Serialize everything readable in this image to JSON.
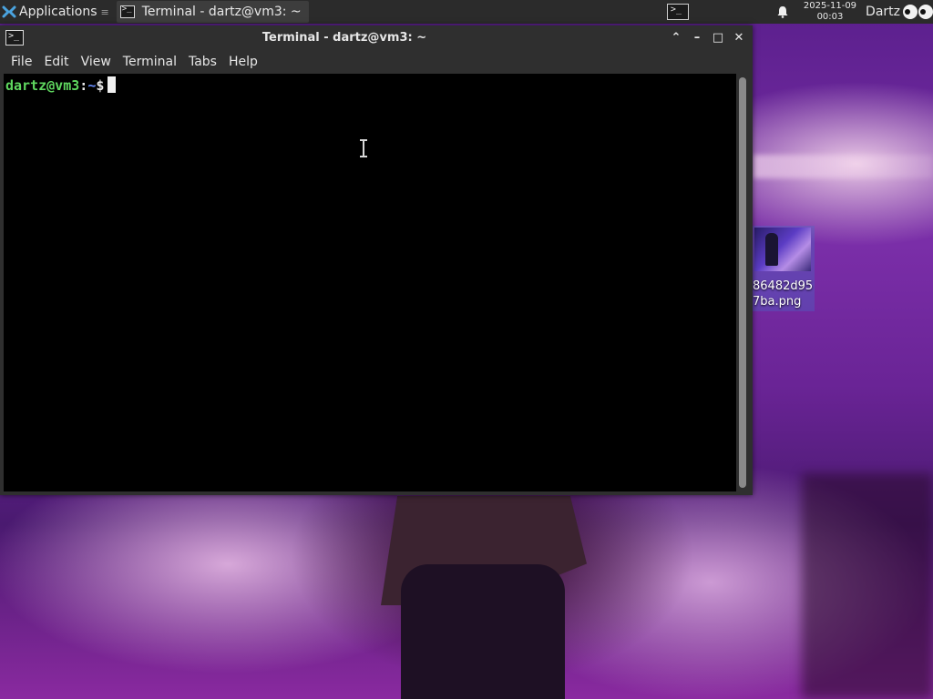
{
  "panel": {
    "applications_label": "Applications",
    "task_label": "Terminal - dartz@vm3: ~",
    "clock_date": "2025-11-09",
    "clock_time": "00:03",
    "user_name": "Dartz"
  },
  "window": {
    "title": "Terminal - dartz@vm3: ~",
    "controls": {
      "shade": "⌃",
      "minimize": "–",
      "maximize": "□",
      "close": "✕"
    },
    "menu": [
      "File",
      "Edit",
      "View",
      "Terminal",
      "Tabs",
      "Help"
    ]
  },
  "terminal": {
    "prompt_user": "dartz@vm3",
    "prompt_colon": ":",
    "prompt_path": "~",
    "prompt_dollar": "$",
    "colors": {
      "user": "#5fd75f",
      "path": "#6a8fff",
      "background": "#000000"
    }
  },
  "desktop_icon": {
    "label": "86482d95\n7ba.png"
  },
  "icons": {
    "apps": "xfce-logo-icon",
    "task": "terminal-icon",
    "tray": "terminal-icon",
    "notify": "bell-icon",
    "user": "eyes-icon"
  }
}
